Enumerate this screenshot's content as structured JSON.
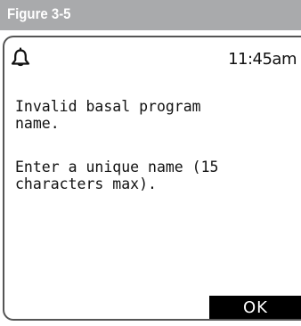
{
  "figure": {
    "label": "Figure 3-5"
  },
  "screen": {
    "status": {
      "icon": "bell-icon",
      "time": "11:45am"
    },
    "message": {
      "line1": "Invalid basal program\nname.",
      "line2": "Enter a unique name (15\ncharacters max)."
    },
    "ok_label": "OK"
  },
  "colors": {
    "figure_tab": "#a9aaac",
    "button_bg": "#000000",
    "button_text": "#ffffff"
  }
}
